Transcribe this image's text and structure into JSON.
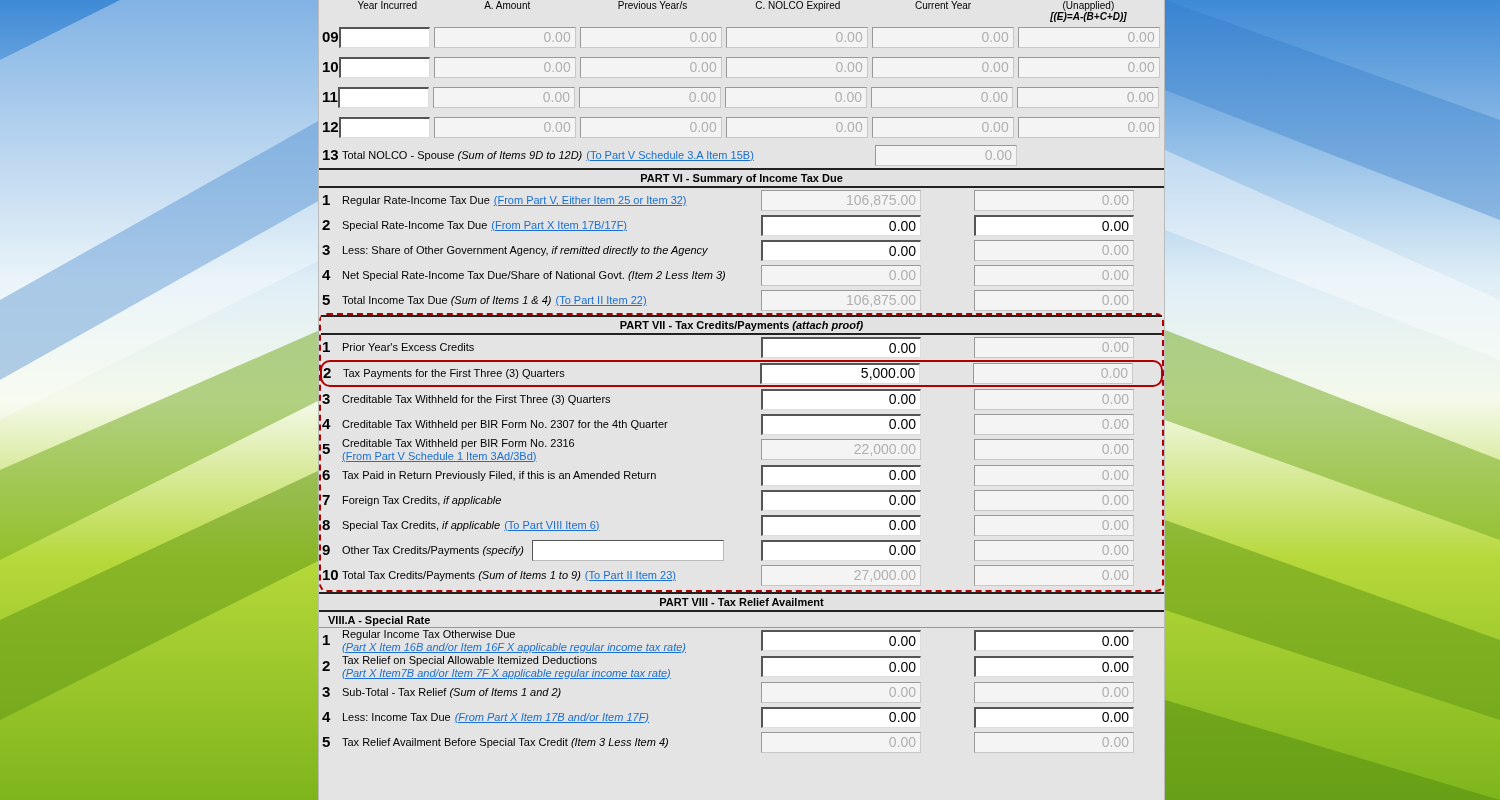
{
  "nolco": {
    "headers": [
      "Year Incurred",
      "A. Amount",
      "Previous Year/s",
      "C. NOLCO Expired",
      "Current Year",
      "(Unapplied)"
    ],
    "header_note": "[(E)=A-(B+C+D)]",
    "rows": [
      {
        "number": "09",
        "cells": [
          {
            "disabled": false
          },
          {
            "value": "0.00",
            "disabled": true
          },
          {
            "value": "0.00",
            "disabled": true
          },
          {
            "value": "0.00",
            "disabled": true
          },
          {
            "value": "0.00",
            "disabled": true
          },
          {
            "value": "0.00",
            "disabled": true
          }
        ]
      },
      {
        "number": "10",
        "cells": [
          {
            "disabled": false
          },
          {
            "value": "0.00",
            "disabled": true
          },
          {
            "value": "0.00",
            "disabled": true
          },
          {
            "value": "0.00",
            "disabled": true
          },
          {
            "value": "0.00",
            "disabled": true
          },
          {
            "value": "0.00",
            "disabled": true
          }
        ]
      },
      {
        "number": "11",
        "cells": [
          {
            "disabled": false
          },
          {
            "value": "0.00",
            "disabled": true
          },
          {
            "value": "0.00",
            "disabled": true
          },
          {
            "value": "0.00",
            "disabled": true
          },
          {
            "value": "0.00",
            "disabled": true
          },
          {
            "value": "0.00",
            "disabled": true
          }
        ]
      },
      {
        "number": "12",
        "cells": [
          {
            "disabled": false
          },
          {
            "value": "0.00",
            "disabled": true
          },
          {
            "value": "0.00",
            "disabled": true
          },
          {
            "value": "0.00",
            "disabled": true
          },
          {
            "value": "0.00",
            "disabled": true
          },
          {
            "value": "0.00",
            "disabled": true
          }
        ]
      }
    ],
    "total": {
      "number": "13",
      "label": "Total NOLCO - Spouse *(Sum of Items 9D to 12D)*",
      "link": "(To Part V Schedule 3.A Item 15B)",
      "value": "0.00",
      "disabled": true
    }
  },
  "parts": [
    {
      "title": "PART VI - Summary of Income Tax Due",
      "highlighted": false,
      "items": [
        {
          "number": "1",
          "label": "Regular Rate-Income Tax Due",
          "link": "(From Part V, Either Item 25 or Item 32)",
          "fields": [
            {
              "value": "106,875.00",
              "disabled": true
            },
            {
              "value": "0.00",
              "disabled": true
            }
          ]
        },
        {
          "number": "2",
          "label": "Special Rate-Income Tax Due",
          "link": "(From Part X Item 17B/17F)",
          "fields": [
            {
              "value": "0.00",
              "disabled": false
            },
            {
              "value": "0.00",
              "disabled": false
            }
          ]
        },
        {
          "number": "3",
          "label": "Less: Share of Other Government Agency, *if remitted directly to the Agency*",
          "fields": [
            {
              "value": "0.00",
              "disabled": false
            },
            {
              "value": "0.00",
              "disabled": true
            }
          ]
        },
        {
          "number": "4",
          "label": "Net Special Rate-Income Tax Due/Share of National Govt. *(Item 2 Less Item 3)*",
          "fields": [
            {
              "value": "0.00",
              "disabled": true
            },
            {
              "value": "0.00",
              "disabled": true
            }
          ]
        },
        {
          "number": "5",
          "label": "Total Income Tax Due *(Sum of Items 1 & 4)*",
          "link": "(To Part II Item 22)",
          "fields": [
            {
              "value": "106,875.00",
              "disabled": true
            },
            {
              "value": "0.00",
              "disabled": true
            }
          ]
        }
      ]
    },
    {
      "title": "PART VII - Tax Credits/Payments *(attach proof)*",
      "highlighted": true,
      "items": [
        {
          "number": "1",
          "kind": "plain",
          "highlighted": false,
          "label": "Prior Year's Excess Credits",
          "fields": [
            {
              "value": "0.00",
              "disabled": false
            },
            {
              "value": "0.00",
              "disabled": true
            }
          ]
        },
        {
          "number": "2",
          "kind": "plain",
          "highlighted": true,
          "label": "Tax Payments for the First Three (3) Quarters",
          "fields": [
            {
              "value": "5,000.00",
              "disabled": false
            },
            {
              "value": "0.00",
              "disabled": true
            }
          ]
        },
        {
          "number": "3",
          "kind": "plain",
          "highlighted": false,
          "label": "Creditable Tax Withheld for the First Three (3) Quarters",
          "fields": [
            {
              "value": "0.00",
              "disabled": false
            },
            {
              "value": "0.00",
              "disabled": true
            }
          ]
        },
        {
          "number": "4",
          "kind": "plain",
          "highlighted": false,
          "label": "Creditable Tax Withheld per BIR Form No. 2307 for the 4th Quarter",
          "fields": [
            {
              "value": "0.00",
              "disabled": false
            },
            {
              "value": "0.00",
              "disabled": true
            }
          ]
        },
        {
          "number": "5",
          "kind": "plain",
          "highlighted": false,
          "label": "Creditable Tax Withheld per BIR Form No. 2316",
          "link": "(From Part V Schedule 1 Item 3Ad/3Bd)",
          "fields": [
            {
              "value": "22,000.00",
              "disabled": true
            },
            {
              "value": "0.00",
              "disabled": true
            }
          ]
        },
        {
          "number": "6",
          "kind": "plain",
          "highlighted": false,
          "label": "Tax Paid in Return Previously Filed, if this is an Amended Return",
          "fields": [
            {
              "value": "0.00",
              "disabled": false
            },
            {
              "value": "0.00",
              "disabled": true
            }
          ]
        },
        {
          "number": "7",
          "kind": "plain",
          "highlighted": false,
          "label": "Foreign Tax Credits, *if applicable*",
          "fields": [
            {
              "value": "0.00",
              "disabled": false
            },
            {
              "value": "0.00",
              "disabled": true
            }
          ]
        },
        {
          "number": "8",
          "kind": "plain",
          "highlighted": false,
          "label": "Special Tax Credits, *if applicable*",
          "link": "(To Part VIII Item 6)",
          "fields": [
            {
              "value": "0.00",
              "disabled": false
            },
            {
              "value": "0.00",
              "disabled": true
            }
          ]
        },
        {
          "number": "9",
          "kind": "specify",
          "highlighted": false,
          "label": "Other Tax Credits/Payments *(specify)*",
          "fields": [
            {
              "value": "0.00",
              "disabled": false
            },
            {
              "value": "0.00",
              "disabled": true
            }
          ]
        },
        {
          "number": "10",
          "kind": "plain",
          "highlighted": false,
          "label": "Total Tax Credits/Payments *(Sum of Items 1 to 9)*",
          "link": "(To Part II Item 23)",
          "fields": [
            {
              "value": "27,000.00",
              "disabled": true
            },
            {
              "value": "0.00",
              "disabled": true
            }
          ]
        }
      ]
    },
    {
      "title": "PART VIII - Tax Relief Availment",
      "highlighted": false,
      "subsection": "VIII.A - Special Rate",
      "items": [
        {
          "number": "1",
          "label": "Regular Income Tax Otherwise Due",
          "link": "(Part X Item 16B and/or Item 16F X applicable regular income tax rate)",
          "link_italic": true,
          "fields": [
            {
              "value": "0.00",
              "disabled": false
            },
            {
              "value": "0.00",
              "disabled": false
            }
          ]
        },
        {
          "number": "2",
          "label": "Tax Relief on Special Allowable Itemized Deductions",
          "link": "(Part X Item7B and/or Item 7F X applicable regular income tax rate)",
          "link_italic": true,
          "fields": [
            {
              "value": "0.00",
              "disabled": false
            },
            {
              "value": "0.00",
              "disabled": false
            }
          ]
        },
        {
          "number": "3",
          "label": "Sub-Total - Tax Relief *(Sum of Items 1 and 2)*",
          "fields": [
            {
              "value": "0.00",
              "disabled": true
            },
            {
              "value": "0.00",
              "disabled": true
            }
          ]
        },
        {
          "number": "4",
          "label": "Less: Income Tax Due",
          "link": "(From Part X Item 17B and/or Item 17F)",
          "link_italic": true,
          "fields": [
            {
              "value": "0.00",
              "disabled": false
            },
            {
              "value": "0.00",
              "disabled": false
            }
          ]
        },
        {
          "number": "5",
          "label": "Tax Relief Availment Before Special Tax Credit *(Item 3 Less Item 4)*",
          "fields": [
            {
              "value": "0.00",
              "disabled": true
            },
            {
              "value": "0.00",
              "disabled": true
            }
          ]
        }
      ]
    }
  ]
}
